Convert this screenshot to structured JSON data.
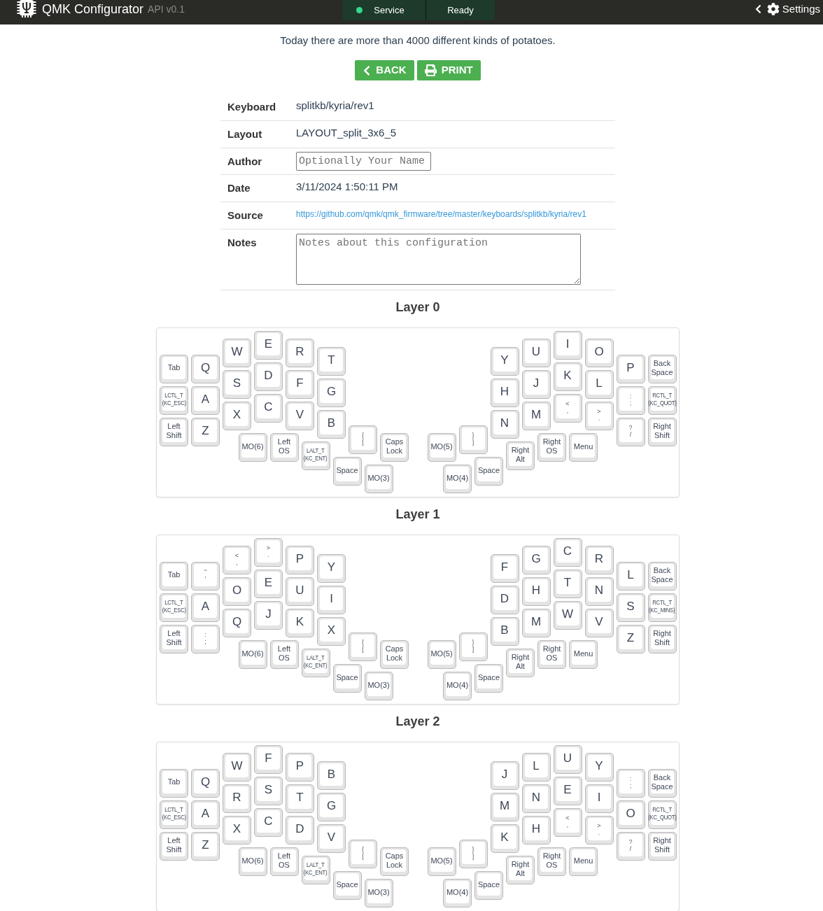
{
  "header": {
    "title": "QMK Configurator",
    "api_version": "API v0.1",
    "status": [
      {
        "label": "Service",
        "indicator": true
      },
      {
        "label": "Ready",
        "indicator": false
      }
    ],
    "settings": "Settings"
  },
  "tip": "Today there are more than 4000 different kinds of potatoes.",
  "buttons": [
    {
      "kind": "back",
      "label": "BACK"
    },
    {
      "kind": "print",
      "label": "PRINT"
    }
  ],
  "info": [
    {
      "kind": "text",
      "label": "Keyboard",
      "value": "splitkb/kyria/rev1"
    },
    {
      "kind": "text",
      "label": "Layout",
      "value": "LAYOUT_split_3x6_5"
    },
    {
      "kind": "input",
      "label": "Author",
      "placeholder": "Optionally Your Name"
    },
    {
      "kind": "text",
      "label": "Date",
      "value": "3/11/2024 1:50:11 PM"
    },
    {
      "kind": "link",
      "label": "Source",
      "value": "https://github.com/qmk/qmk_firmware/tree/master/keyboards/splitkb/kyria/rev1"
    },
    {
      "kind": "textarea",
      "label": "Notes",
      "placeholder": "Notes about this configuration"
    }
  ],
  "layers": [
    {
      "title": "Layer 0",
      "left": [
        {
          "kind": "word",
          "lines": [
            "Tab"
          ]
        },
        {
          "kind": "char",
          "lines": [
            "Q"
          ]
        },
        {
          "kind": "char",
          "lines": [
            "W"
          ]
        },
        {
          "kind": "char",
          "lines": [
            "E"
          ]
        },
        {
          "kind": "char",
          "lines": [
            "R"
          ]
        },
        {
          "kind": "char",
          "lines": [
            "T"
          ]
        },
        {
          "kind": "word",
          "lines": [
            "LCTL_T",
            "(KC_ESC)"
          ]
        },
        {
          "kind": "char",
          "lines": [
            "A"
          ]
        },
        {
          "kind": "char",
          "lines": [
            "S"
          ]
        },
        {
          "kind": "char",
          "lines": [
            "D"
          ]
        },
        {
          "kind": "char",
          "lines": [
            "F"
          ]
        },
        {
          "kind": "char",
          "lines": [
            "G"
          ]
        },
        {
          "kind": "word",
          "lines": [
            "Left",
            "Shift"
          ]
        },
        {
          "kind": "char",
          "lines": [
            "Z"
          ]
        },
        {
          "kind": "char",
          "lines": [
            "X"
          ]
        },
        {
          "kind": "char",
          "lines": [
            "C"
          ]
        },
        {
          "kind": "char",
          "lines": [
            "V"
          ]
        },
        {
          "kind": "char",
          "lines": [
            "B"
          ]
        },
        {
          "kind": "word",
          "lines": [
            "MO(6)"
          ]
        },
        {
          "kind": "word",
          "lines": [
            "Left",
            "OS"
          ]
        },
        {
          "kind": "word",
          "lines": [
            "LALT_T",
            "(KC_ENT)"
          ]
        },
        {
          "kind": "shifted",
          "lines": [
            "{",
            "["
          ]
        },
        {
          "kind": "word",
          "lines": [
            "Caps",
            "Lock"
          ]
        },
        {
          "kind": "word",
          "lines": [
            "Space"
          ]
        },
        {
          "kind": "word",
          "lines": [
            "MO(3)"
          ]
        }
      ],
      "right": [
        {
          "kind": "char",
          "lines": [
            "Y"
          ]
        },
        {
          "kind": "char",
          "lines": [
            "U"
          ]
        },
        {
          "kind": "char",
          "lines": [
            "I"
          ]
        },
        {
          "kind": "char",
          "lines": [
            "O"
          ]
        },
        {
          "kind": "char",
          "lines": [
            "P"
          ]
        },
        {
          "kind": "word",
          "lines": [
            "Back",
            "Space"
          ]
        },
        {
          "kind": "char",
          "lines": [
            "H"
          ]
        },
        {
          "kind": "char",
          "lines": [
            "J"
          ]
        },
        {
          "kind": "char",
          "lines": [
            "K"
          ]
        },
        {
          "kind": "char",
          "lines": [
            "L"
          ]
        },
        {
          "kind": "shifted",
          "lines": [
            ":",
            ";"
          ]
        },
        {
          "kind": "word",
          "lines": [
            "RCTL_T",
            "(KC_QUOT)"
          ]
        },
        {
          "kind": "char",
          "lines": [
            "N"
          ]
        },
        {
          "kind": "char",
          "lines": [
            "M"
          ]
        },
        {
          "kind": "shifted",
          "lines": [
            "<",
            ","
          ]
        },
        {
          "kind": "shifted",
          "lines": [
            ">",
            "."
          ]
        },
        {
          "kind": "shifted",
          "lines": [
            "?",
            "/"
          ]
        },
        {
          "kind": "word",
          "lines": [
            "Right",
            "Shift"
          ]
        },
        {
          "kind": "word",
          "lines": [
            "MO(5)"
          ]
        },
        {
          "kind": "shifted",
          "lines": [
            "}",
            "]"
          ]
        },
        {
          "kind": "word",
          "lines": [
            "Right",
            "Alt"
          ]
        },
        {
          "kind": "word",
          "lines": [
            "Right",
            "OS"
          ]
        },
        {
          "kind": "word",
          "lines": [
            "Menu"
          ]
        },
        {
          "kind": "word",
          "lines": [
            "MO(4)"
          ]
        },
        {
          "kind": "word",
          "lines": [
            "Space"
          ]
        }
      ]
    },
    {
      "title": "Layer 1",
      "left": [
        {
          "kind": "word",
          "lines": [
            "Tab"
          ]
        },
        {
          "kind": "shifted",
          "lines": [
            "\"",
            "'"
          ]
        },
        {
          "kind": "shifted",
          "lines": [
            "<",
            ","
          ]
        },
        {
          "kind": "shifted",
          "lines": [
            ">",
            "."
          ]
        },
        {
          "kind": "char",
          "lines": [
            "P"
          ]
        },
        {
          "kind": "char",
          "lines": [
            "Y"
          ]
        },
        {
          "kind": "word",
          "lines": [
            "LCTL_T",
            "(KC_ESC)"
          ]
        },
        {
          "kind": "char",
          "lines": [
            "A"
          ]
        },
        {
          "kind": "char",
          "lines": [
            "O"
          ]
        },
        {
          "kind": "char",
          "lines": [
            "E"
          ]
        },
        {
          "kind": "char",
          "lines": [
            "U"
          ]
        },
        {
          "kind": "char",
          "lines": [
            "I"
          ]
        },
        {
          "kind": "word",
          "lines": [
            "Left",
            "Shift"
          ]
        },
        {
          "kind": "shifted",
          "lines": [
            ":",
            ";"
          ]
        },
        {
          "kind": "char",
          "lines": [
            "Q"
          ]
        },
        {
          "kind": "char",
          "lines": [
            "J"
          ]
        },
        {
          "kind": "char",
          "lines": [
            "K"
          ]
        },
        {
          "kind": "char",
          "lines": [
            "X"
          ]
        },
        {
          "kind": "word",
          "lines": [
            "MO(6)"
          ]
        },
        {
          "kind": "word",
          "lines": [
            "Left",
            "OS"
          ]
        },
        {
          "kind": "word",
          "lines": [
            "LALT_T",
            "(KC_ENT)"
          ]
        },
        {
          "kind": "shifted",
          "lines": [
            "{",
            "["
          ]
        },
        {
          "kind": "word",
          "lines": [
            "Caps",
            "Lock"
          ]
        },
        {
          "kind": "word",
          "lines": [
            "Space"
          ]
        },
        {
          "kind": "word",
          "lines": [
            "MO(3)"
          ]
        }
      ],
      "right": [
        {
          "kind": "char",
          "lines": [
            "F"
          ]
        },
        {
          "kind": "char",
          "lines": [
            "G"
          ]
        },
        {
          "kind": "char",
          "lines": [
            "C"
          ]
        },
        {
          "kind": "char",
          "lines": [
            "R"
          ]
        },
        {
          "kind": "char",
          "lines": [
            "L"
          ]
        },
        {
          "kind": "word",
          "lines": [
            "Back",
            "Space"
          ]
        },
        {
          "kind": "char",
          "lines": [
            "D"
          ]
        },
        {
          "kind": "char",
          "lines": [
            "H"
          ]
        },
        {
          "kind": "char",
          "lines": [
            "T"
          ]
        },
        {
          "kind": "char",
          "lines": [
            "N"
          ]
        },
        {
          "kind": "char",
          "lines": [
            "S"
          ]
        },
        {
          "kind": "word",
          "lines": [
            "RCTL_T",
            "(KC_MINS)"
          ]
        },
        {
          "kind": "char",
          "lines": [
            "B"
          ]
        },
        {
          "kind": "char",
          "lines": [
            "M"
          ]
        },
        {
          "kind": "char",
          "lines": [
            "W"
          ]
        },
        {
          "kind": "char",
          "lines": [
            "V"
          ]
        },
        {
          "kind": "char",
          "lines": [
            "Z"
          ]
        },
        {
          "kind": "word",
          "lines": [
            "Right",
            "Shift"
          ]
        },
        {
          "kind": "word",
          "lines": [
            "MO(5)"
          ]
        },
        {
          "kind": "shifted",
          "lines": [
            "}",
            "]"
          ]
        },
        {
          "kind": "word",
          "lines": [
            "Right",
            "Alt"
          ]
        },
        {
          "kind": "word",
          "lines": [
            "Right",
            "OS"
          ]
        },
        {
          "kind": "word",
          "lines": [
            "Menu"
          ]
        },
        {
          "kind": "word",
          "lines": [
            "MO(4)"
          ]
        },
        {
          "kind": "word",
          "lines": [
            "Space"
          ]
        }
      ]
    },
    {
      "title": "Layer 2",
      "left": [
        {
          "kind": "word",
          "lines": [
            "Tab"
          ]
        },
        {
          "kind": "char",
          "lines": [
            "Q"
          ]
        },
        {
          "kind": "char",
          "lines": [
            "W"
          ]
        },
        {
          "kind": "char",
          "lines": [
            "F"
          ]
        },
        {
          "kind": "char",
          "lines": [
            "P"
          ]
        },
        {
          "kind": "char",
          "lines": [
            "B"
          ]
        },
        {
          "kind": "word",
          "lines": [
            "LCTL_T",
            "(KC_ESC)"
          ]
        },
        {
          "kind": "char",
          "lines": [
            "A"
          ]
        },
        {
          "kind": "char",
          "lines": [
            "R"
          ]
        },
        {
          "kind": "char",
          "lines": [
            "S"
          ]
        },
        {
          "kind": "char",
          "lines": [
            "T"
          ]
        },
        {
          "kind": "char",
          "lines": [
            "G"
          ]
        },
        {
          "kind": "word",
          "lines": [
            "Left",
            "Shift"
          ]
        },
        {
          "kind": "char",
          "lines": [
            "Z"
          ]
        },
        {
          "kind": "char",
          "lines": [
            "X"
          ]
        },
        {
          "kind": "char",
          "lines": [
            "C"
          ]
        },
        {
          "kind": "char",
          "lines": [
            "D"
          ]
        },
        {
          "kind": "char",
          "lines": [
            "V"
          ]
        },
        {
          "kind": "word",
          "lines": [
            "MO(6)"
          ]
        },
        {
          "kind": "word",
          "lines": [
            "Left",
            "OS"
          ]
        },
        {
          "kind": "word",
          "lines": [
            "LALT_T",
            "(KC_ENT)"
          ]
        },
        {
          "kind": "shifted",
          "lines": [
            "{",
            "["
          ]
        },
        {
          "kind": "word",
          "lines": [
            "Caps",
            "Lock"
          ]
        },
        {
          "kind": "word",
          "lines": [
            "Space"
          ]
        },
        {
          "kind": "word",
          "lines": [
            "MO(3)"
          ]
        }
      ],
      "right": [
        {
          "kind": "char",
          "lines": [
            "J"
          ]
        },
        {
          "kind": "char",
          "lines": [
            "L"
          ]
        },
        {
          "kind": "char",
          "lines": [
            "U"
          ]
        },
        {
          "kind": "char",
          "lines": [
            "Y"
          ]
        },
        {
          "kind": "shifted",
          "lines": [
            ":",
            ";"
          ]
        },
        {
          "kind": "word",
          "lines": [
            "Back",
            "Space"
          ]
        },
        {
          "kind": "char",
          "lines": [
            "M"
          ]
        },
        {
          "kind": "char",
          "lines": [
            "N"
          ]
        },
        {
          "kind": "char",
          "lines": [
            "E"
          ]
        },
        {
          "kind": "char",
          "lines": [
            "I"
          ]
        },
        {
          "kind": "char",
          "lines": [
            "O"
          ]
        },
        {
          "kind": "word",
          "lines": [
            "RCTL_T",
            "(KC_QUOT)"
          ]
        },
        {
          "kind": "char",
          "lines": [
            "K"
          ]
        },
        {
          "kind": "char",
          "lines": [
            "H"
          ]
        },
        {
          "kind": "shifted",
          "lines": [
            "<",
            ","
          ]
        },
        {
          "kind": "shifted",
          "lines": [
            ">",
            "."
          ]
        },
        {
          "kind": "shifted",
          "lines": [
            "?",
            "/"
          ]
        },
        {
          "kind": "word",
          "lines": [
            "Right",
            "Shift"
          ]
        },
        {
          "kind": "word",
          "lines": [
            "MO(5)"
          ]
        },
        {
          "kind": "shifted",
          "lines": [
            "}",
            "]"
          ]
        },
        {
          "kind": "word",
          "lines": [
            "Right",
            "Alt"
          ]
        },
        {
          "kind": "word",
          "lines": [
            "Right",
            "OS"
          ]
        },
        {
          "kind": "word",
          "lines": [
            "Menu"
          ]
        },
        {
          "kind": "word",
          "lines": [
            "MO(4)"
          ]
        },
        {
          "kind": "word",
          "lines": [
            "Space"
          ]
        }
      ]
    }
  ]
}
